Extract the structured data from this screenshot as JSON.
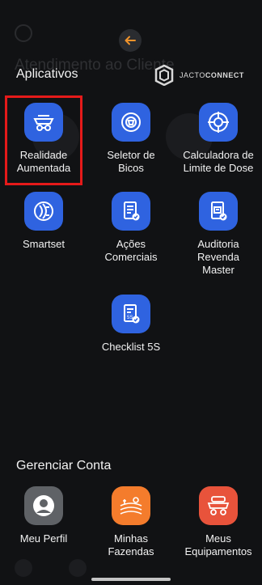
{
  "background": {
    "title": "Atendimento ao Cliente"
  },
  "header": {
    "back_icon": "arrow-left-icon",
    "logo": {
      "text_light": "JACTO",
      "text_bold": "CONNECT"
    }
  },
  "sections": {
    "apps_title": "Aplicativos",
    "account_title": "Gerenciar Conta"
  },
  "apps": [
    {
      "label": "Realidade\nAumentada",
      "icon": "augmented-reality-icon",
      "highlighted": true
    },
    {
      "label": "Seletor de\nBicos",
      "icon": "nozzle-selector-icon"
    },
    {
      "label": "Calculadora de\nLimite de Dose",
      "icon": "dose-calculator-icon"
    },
    {
      "label": "Smartset",
      "icon": "smartset-icon"
    },
    {
      "label": "Ações\nComerciais",
      "icon": "commercial-actions-icon"
    },
    {
      "label": "Auditoria\nRevenda\nMaster",
      "icon": "audit-icon"
    },
    {
      "label": "Checklist 5S",
      "icon": "checklist-5s-icon"
    }
  ],
  "account": [
    {
      "label": "Meu Perfil",
      "icon": "profile-icon"
    },
    {
      "label": "Minhas\nFazendas",
      "icon": "farm-icon"
    },
    {
      "label": "Meus\nEquipamentos",
      "icon": "equipment-icon"
    }
  ],
  "colors": {
    "accent": "#2f63e0",
    "back_arrow": "#f0932b",
    "highlight": "#e51a1a"
  }
}
